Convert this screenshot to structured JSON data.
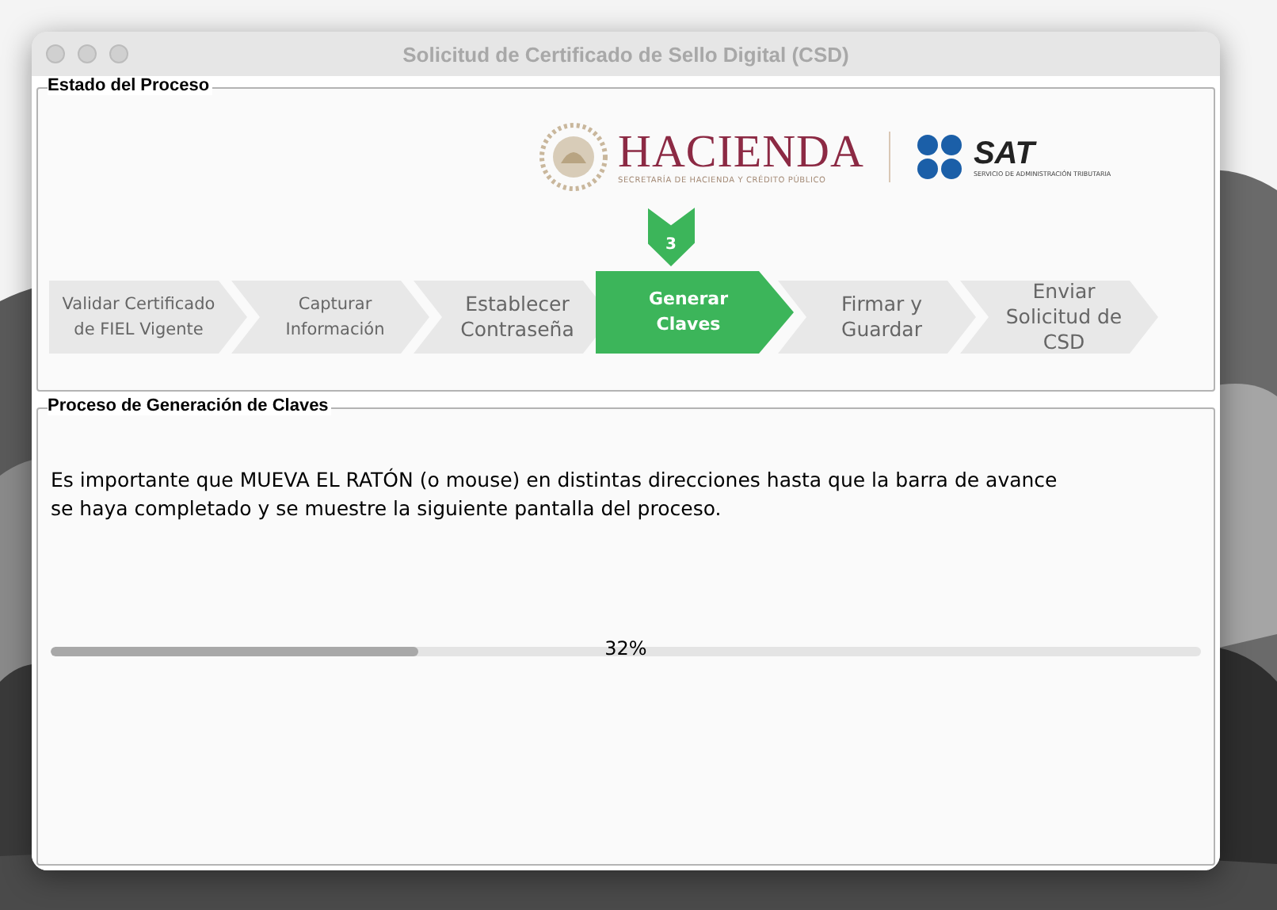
{
  "window": {
    "title": "Solicitud de Certificado de Sello Digital (CSD)"
  },
  "status_panel": {
    "title": "Estado del Proceso",
    "logo": {
      "hacienda": "HACIENDA",
      "hacienda_sub": "SECRETARÍA DE HACIENDA Y CRÉDITO PÚBLICO",
      "sat": "SAT",
      "sat_sub": "SERVICIO DE ADMINISTRACIÓN TRIBUTARIA"
    },
    "step_marker": "3",
    "steps": [
      {
        "label": "Validar Certificado de FIEL Vigente",
        "selected": false
      },
      {
        "label": "Capturar Información",
        "selected": false
      },
      {
        "label": "Establecer Contraseña",
        "selected": false
      },
      {
        "label": "Generar Claves",
        "selected": true
      },
      {
        "label": "Firmar y Guardar",
        "selected": false
      },
      {
        "label": "Enviar Solicitud de CSD",
        "selected": false
      }
    ]
  },
  "keys_panel": {
    "title": "Proceso de Generación de Claves",
    "message": "Es importante que MUEVA EL RATÓN (o mouse) en distintas direcciones hasta que la barra de avance se haya completado y se muestre la siguiente pantalla del proceso.",
    "progress": {
      "level": 0.32,
      "reading": "32%"
    }
  }
}
